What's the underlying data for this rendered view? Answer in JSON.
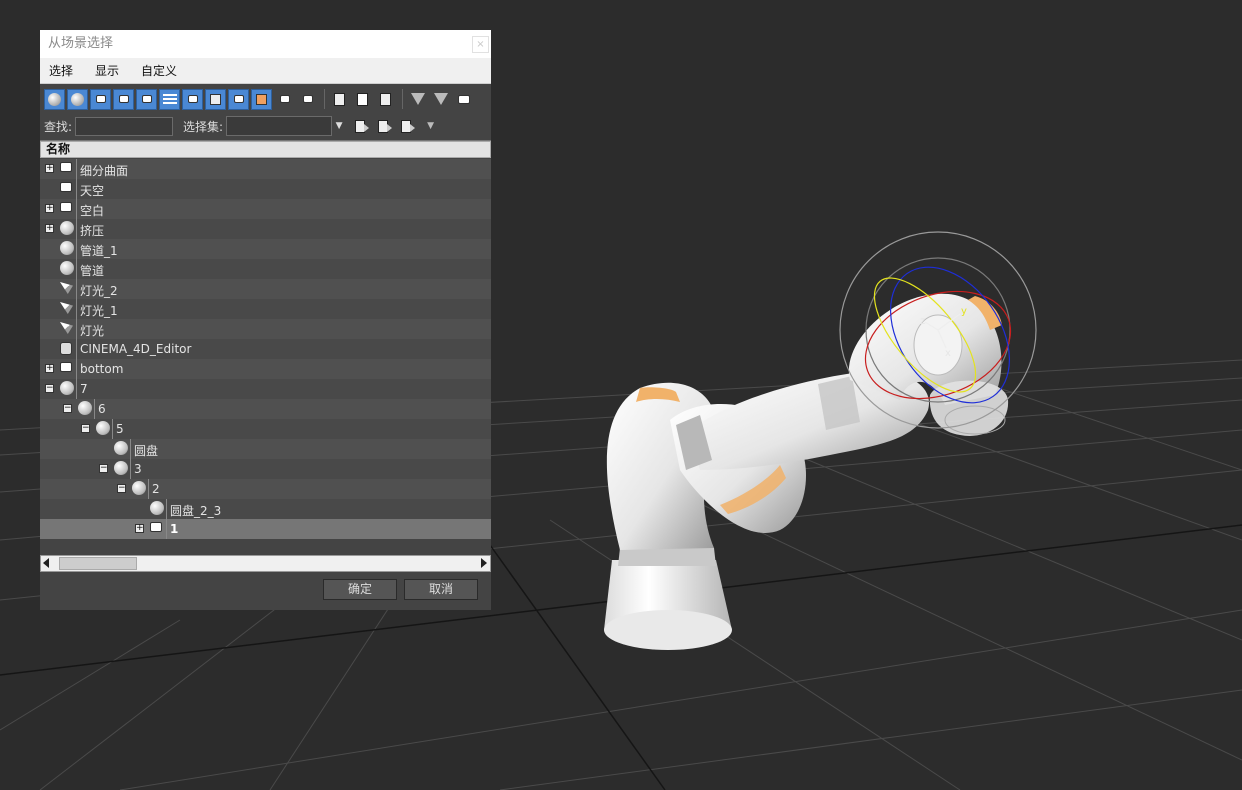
{
  "dialog": {
    "title": "从场景选择",
    "close_label": "×"
  },
  "menu": [
    "选择",
    "显示",
    "自定义"
  ],
  "toolbar": {
    "icons": [
      "geometry-filter-icon",
      "shapes-filter-icon",
      "lights-filter-icon",
      "cameras-filter-icon",
      "helpers-filter-icon",
      "spacewarps-filter-icon",
      "groups-filter-icon",
      "xrefs-filter-icon",
      "bones-filter-icon",
      "containers-filter-icon",
      "frozen-filter-icon",
      "hidden-filter-icon",
      "select-all-icon",
      "select-none-icon",
      "select-invert-icon",
      "filter-icon",
      "filter-options-icon",
      "collapse-icon"
    ]
  },
  "search": {
    "find_label": "查找:",
    "find_value": "",
    "selset_label": "选择集:",
    "selset_value": ""
  },
  "list": {
    "column_header": "名称",
    "rows": [
      {
        "label": "细分曲面",
        "depth": 0,
        "icon": "object",
        "expander": "+"
      },
      {
        "label": "天空",
        "depth": 0,
        "icon": "object",
        "expander": ""
      },
      {
        "label": "空白",
        "depth": 0,
        "icon": "object",
        "expander": "+"
      },
      {
        "label": "挤压",
        "depth": 0,
        "icon": "sphere",
        "expander": "+"
      },
      {
        "label": "管道_1",
        "depth": 0,
        "icon": "sphere",
        "expander": ""
      },
      {
        "label": "管道",
        "depth": 0,
        "icon": "sphere",
        "expander": ""
      },
      {
        "label": "灯光_2",
        "depth": 0,
        "icon": "light",
        "expander": ""
      },
      {
        "label": "灯光_1",
        "depth": 0,
        "icon": "light",
        "expander": ""
      },
      {
        "label": "灯光",
        "depth": 0,
        "icon": "light",
        "expander": ""
      },
      {
        "label": "CINEMA_4D_Editor",
        "depth": 0,
        "icon": "camera",
        "expander": ""
      },
      {
        "label": "bottom",
        "depth": 0,
        "icon": "object",
        "expander": "+"
      },
      {
        "label": "7",
        "depth": 0,
        "icon": "sphere",
        "expander": "−"
      },
      {
        "label": "6",
        "depth": 1,
        "icon": "sphere",
        "expander": "−"
      },
      {
        "label": "5",
        "depth": 2,
        "icon": "sphere",
        "expander": "−"
      },
      {
        "label": "圆盘",
        "depth": 3,
        "icon": "sphere",
        "expander": ""
      },
      {
        "label": "3",
        "depth": 3,
        "icon": "sphere",
        "expander": "−"
      },
      {
        "label": "2",
        "depth": 4,
        "icon": "sphere",
        "expander": "−"
      },
      {
        "label": "圆盘_2_3",
        "depth": 5,
        "icon": "sphere",
        "expander": ""
      },
      {
        "label": "1",
        "depth": 5,
        "icon": "object",
        "expander": "+",
        "selected": true
      }
    ]
  },
  "buttons": {
    "ok": "确定",
    "cancel": "取消"
  },
  "scene": {
    "gizmo_axes": [
      "z",
      "y",
      "x"
    ],
    "background": "#2c2c2c",
    "accent": "#4a88d4"
  }
}
